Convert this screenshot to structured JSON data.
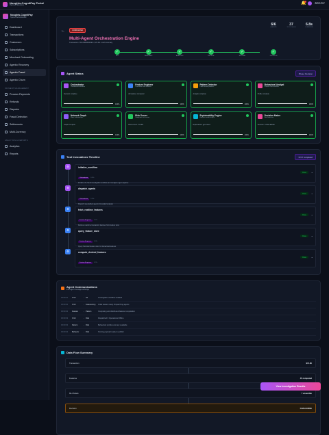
{
  "topbar": {
    "app_title": "Noughts-CognitPay Portal",
    "app_sub": "Payment Solutions",
    "user_name": "Admin User",
    "user_role": "Administrator"
  },
  "sidebar": {
    "brand_title": "Noughts-CognitPay",
    "brand_sub": "System Administrator",
    "items": [
      {
        "label": "Dashboard"
      },
      {
        "label": "Transactions"
      },
      {
        "label": "Customers"
      },
      {
        "label": "Subscriptions"
      },
      {
        "label": "Merchant Onboarding"
      },
      {
        "label": "Agentic Recovery"
      },
      {
        "label": "Agentic Fraud",
        "active": true
      },
      {
        "label": "Agentic Churn"
      }
    ],
    "section_payment": "PAYMENT MANAGEMENT",
    "payment_items": [
      {
        "label": "Process Payments"
      },
      {
        "label": "Refunds"
      },
      {
        "label": "Disputes"
      },
      {
        "label": "Fraud Detection"
      },
      {
        "label": "Settlements"
      },
      {
        "label": "Multi-Currency"
      }
    ],
    "section_analytics": "ANALYTICS & REPORTS",
    "analytics_items": [
      {
        "label": "Analytics"
      },
      {
        "label": "Reports"
      }
    ]
  },
  "header": {
    "badge": "COMPLETED",
    "title": "Multi-Agent Orchestration Engine",
    "subtitle": "Transaction TXN-9382840293 • $74.80 • Auth Anomaly",
    "stats": [
      {
        "value": "6/6",
        "label": "AGENTS"
      },
      {
        "value": "37",
        "label": "TOOL CALLS"
      },
      {
        "value": "6.8s",
        "label": "DURATION"
      }
    ],
    "steps": [
      "INIT",
      "FEATURES",
      "ANALYSIS",
      "PROFILE",
      "EXPLAIN",
      "DECISION"
    ]
  },
  "agent_status": {
    "title": "Agent Status",
    "button": "Phase: Decision",
    "agents": [
      {
        "name": "Orchestrator",
        "desc": "Coordinates workflow",
        "status": "Decision complete",
        "pct": "100%",
        "color": "#a855f7"
      },
      {
        "name": "Feature Engineer",
        "desc": "Transforms raw features",
        "status": "All features computed",
        "pct": "100%",
        "color": "#3b82f6"
      },
      {
        "name": "Pattern Detector",
        "desc": "Finds known patterns",
        "status": "Analysis complete",
        "pct": "100%",
        "color": "#f59e0b"
      },
      {
        "name": "Behavioral Analyst",
        "desc": "Profiles user behavior",
        "status": "Profile complete",
        "pct": "100%",
        "color": "#ec4899"
      },
      {
        "name": "Network Graph",
        "desc": "Maps relationships",
        "status": "Graph complete",
        "pct": "100%",
        "color": "#8b5cf6"
      },
      {
        "name": "Risk Scorer",
        "desc": "Computes risk scores",
        "status": "Risk scored: 74.25%",
        "pct": "100%",
        "color": "#22c55e"
      },
      {
        "name": "Explainability Engine",
        "desc": "Explains model output",
        "status": "Explanations generated",
        "pct": "100%",
        "color": "#06b6d4"
      },
      {
        "name": "Decision Maker",
        "desc": "Final decision",
        "status": "Decision: CHALLENGE",
        "pct": "100%",
        "color": "#ec4899"
      }
    ]
  },
  "timeline": {
    "title": "Tool Invocations Timeline",
    "count": "37/37 completed",
    "items": [
      {
        "name": "initialize_workflow",
        "tag": "Orchestrator",
        "time": "0.02s",
        "desc": "Initialize the fraud investigation workflow and configure agent pipeline",
        "status": "Done",
        "color": "#a855f7"
      },
      {
        "name": "dispatch_agents",
        "tag": "Orchestrator",
        "time": "0.03s",
        "desc": "Dispatch specialized agents for parallel analysis",
        "status": "Done",
        "color": "#a855f7"
      },
      {
        "name": "fetch_realtime_features",
        "tag": "Feature Engineer",
        "time": "0.12s",
        "desc": "Retrieve real-time transaction features from feature store",
        "status": "Done",
        "color": "#3b82f6"
      },
      {
        "name": "query_feature_store",
        "tag": "Feature Engineer",
        "time": "0.08s",
        "desc": "Query historical feature store for behavioral features",
        "status": "Done",
        "color": "#3b82f6"
      },
      {
        "name": "compute_derived_features",
        "tag": "Feature Engineer",
        "time": "0.15s",
        "desc": "",
        "status": "Done",
        "color": "#3b82f6"
      }
    ]
  },
  "comms": {
    "title": "Agent Communications",
    "sub": "Inter-agent message exchange",
    "rows": [
      {
        "time": "00:00:01",
        "from": "Orch",
        "to": "All",
        "msg": "Investigation workflow initiated"
      },
      {
        "time": "00:00:02",
        "from": "Orch",
        "to": "Feature Eng",
        "msg": "Initial feature ready. Dispatching agents"
      },
      {
        "time": "00:00:02",
        "from": "Feature",
        "to": "Pattern",
        "msg": "Computing and distributed feature computation"
      },
      {
        "time": "00:00:03",
        "from": "Orch",
        "to": "Risk",
        "msg": "Dispatched 6 Operational Offline"
      },
      {
        "time": "00:00:03",
        "from": "Pattern",
        "to": "Risk",
        "msg": "Behavioral profile summary available"
      },
      {
        "time": "00:00:04",
        "from": "Behavior",
        "to": "Risk",
        "msg": "Scoring payload ready to publish"
      }
    ]
  },
  "flow": {
    "title": "Data Flow Summary",
    "rows": [
      {
        "label": "Transaction",
        "value": "$74.80"
      },
      {
        "label": "Features",
        "value": "45 computed"
      },
      {
        "label": "ML Models",
        "value": "7 ensemble"
      },
      {
        "label": "Decision",
        "value": "CHALLENGE"
      }
    ]
  },
  "cta": "View Investigation Results"
}
